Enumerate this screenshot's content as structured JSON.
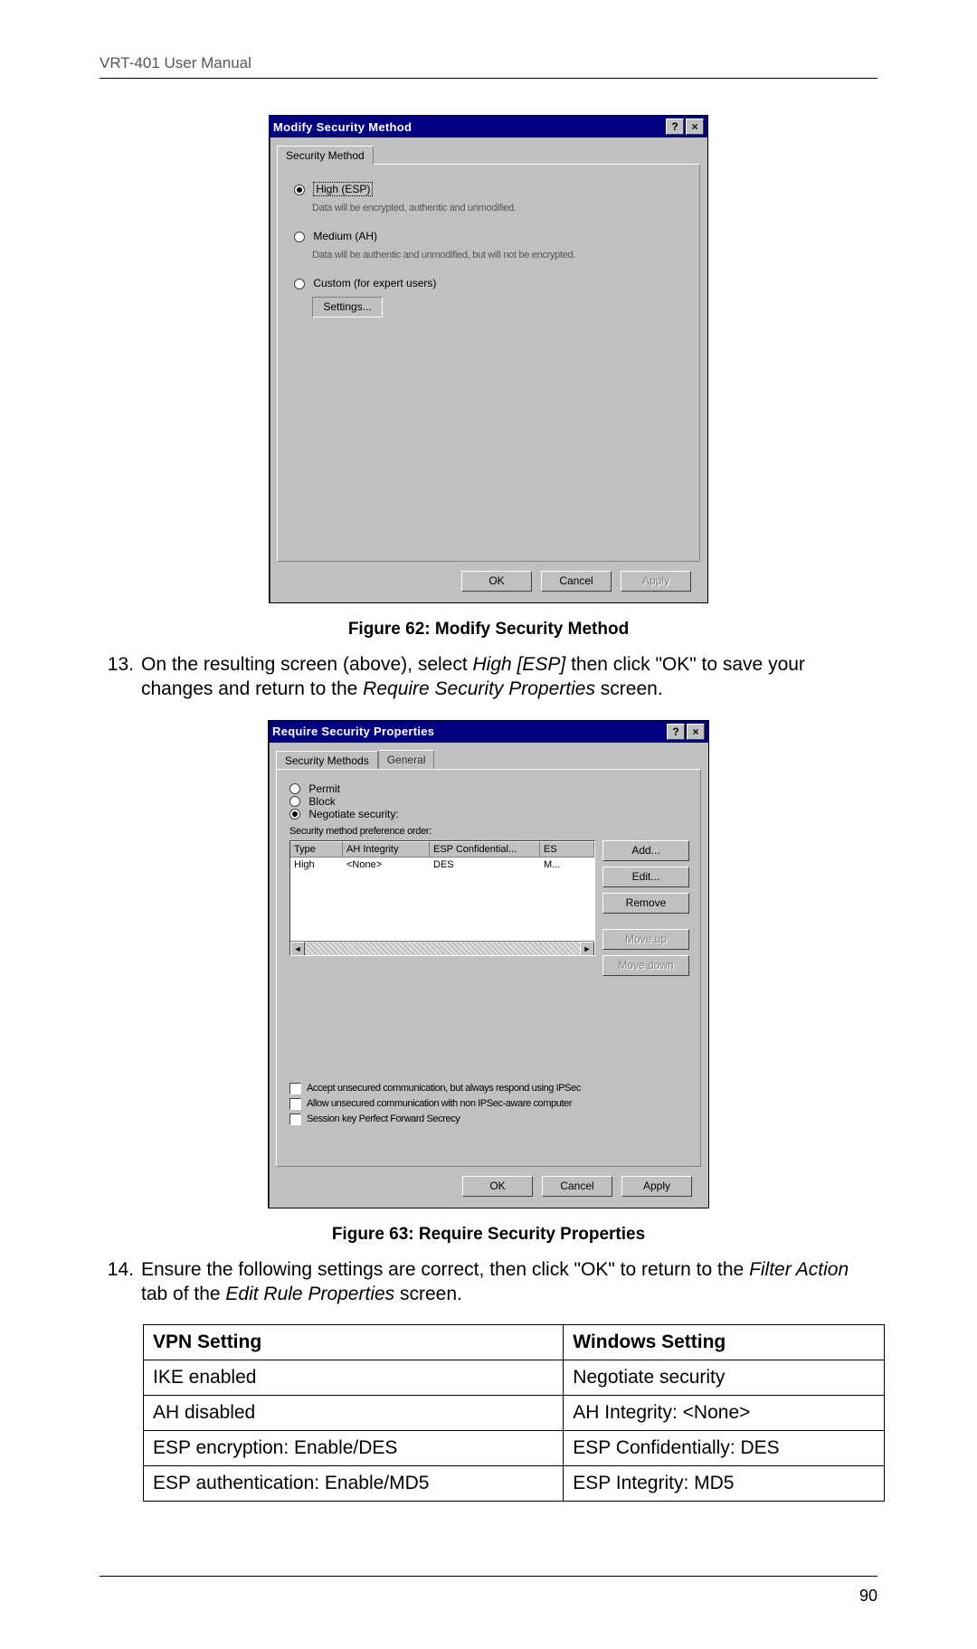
{
  "header": "VRT-401 User Manual",
  "dialog1": {
    "title": "Modify Security Method",
    "help_btn": "?",
    "close_btn": "×",
    "tab": "Security Method",
    "opt_high": "High (ESP)",
    "opt_high_desc": "Data will be encrypted, authentic and unmodified.",
    "opt_medium": "Medium (AH)",
    "opt_medium_desc": "Data will be authentic and unmodified, but will not be encrypted.",
    "opt_custom": "Custom (for expert users)",
    "settings_btn": "Settings...",
    "ok": "OK",
    "cancel": "Cancel",
    "apply": "Apply"
  },
  "caption1": "Figure 62: Modify Security Method",
  "step13_num": "13.",
  "step13_a": "On the resulting screen (above), select ",
  "step13_b": "High [ESP]",
  "step13_c": " then click \"OK\" to save your changes and return to the ",
  "step13_d": "Require Security Properties",
  "step13_e": " screen.",
  "dialog2": {
    "title": "Require Security Properties",
    "tab1": "Security Methods",
    "tab2": "General",
    "opt_permit": "Permit",
    "opt_block": "Block",
    "opt_negotiate": "Negotiate security:",
    "pref_label": "Security method preference order:",
    "col_type": "Type",
    "col_ah": "AH Integrity",
    "col_esp": "ESP Confidential...",
    "col_es2": "ES",
    "row_type": "High",
    "row_ah": "<None>",
    "row_esp": "DES",
    "row_es2": "M...",
    "btn_add": "Add...",
    "btn_edit": "Edit...",
    "btn_remove": "Remove",
    "btn_moveup": "Move up",
    "btn_movedown": "Move down",
    "chk1": "Accept unsecured communication, but always respond using IPSec",
    "chk2": "Allow unsecured communication with non IPSec-aware computer",
    "chk3": "Session key Perfect Forward Secrecy",
    "ok": "OK",
    "cancel": "Cancel",
    "apply": "Apply"
  },
  "caption2": "Figure 63: Require Security Properties",
  "step14_num": "14.",
  "step14_a": "Ensure the following settings are correct, then click \"OK\" to return to the ",
  "step14_b": "Filter Action",
  "step14_c": " tab of the ",
  "step14_d": "Edit Rule Properties",
  "step14_e": " screen.",
  "table": {
    "h1": "VPN Setting",
    "h2": "Windows Setting",
    "r1c1": "IKE enabled",
    "r1c2": "Negotiate security",
    "r2c1": "AH disabled",
    "r2c2": "AH Integrity: <None>",
    "r3c1": "ESP encryption: Enable/DES",
    "r3c2": "ESP Confidentially: DES",
    "r4c1": "ESP authentication: Enable/MD5",
    "r4c2": "ESP Integrity: MD5"
  },
  "page_number": "90"
}
